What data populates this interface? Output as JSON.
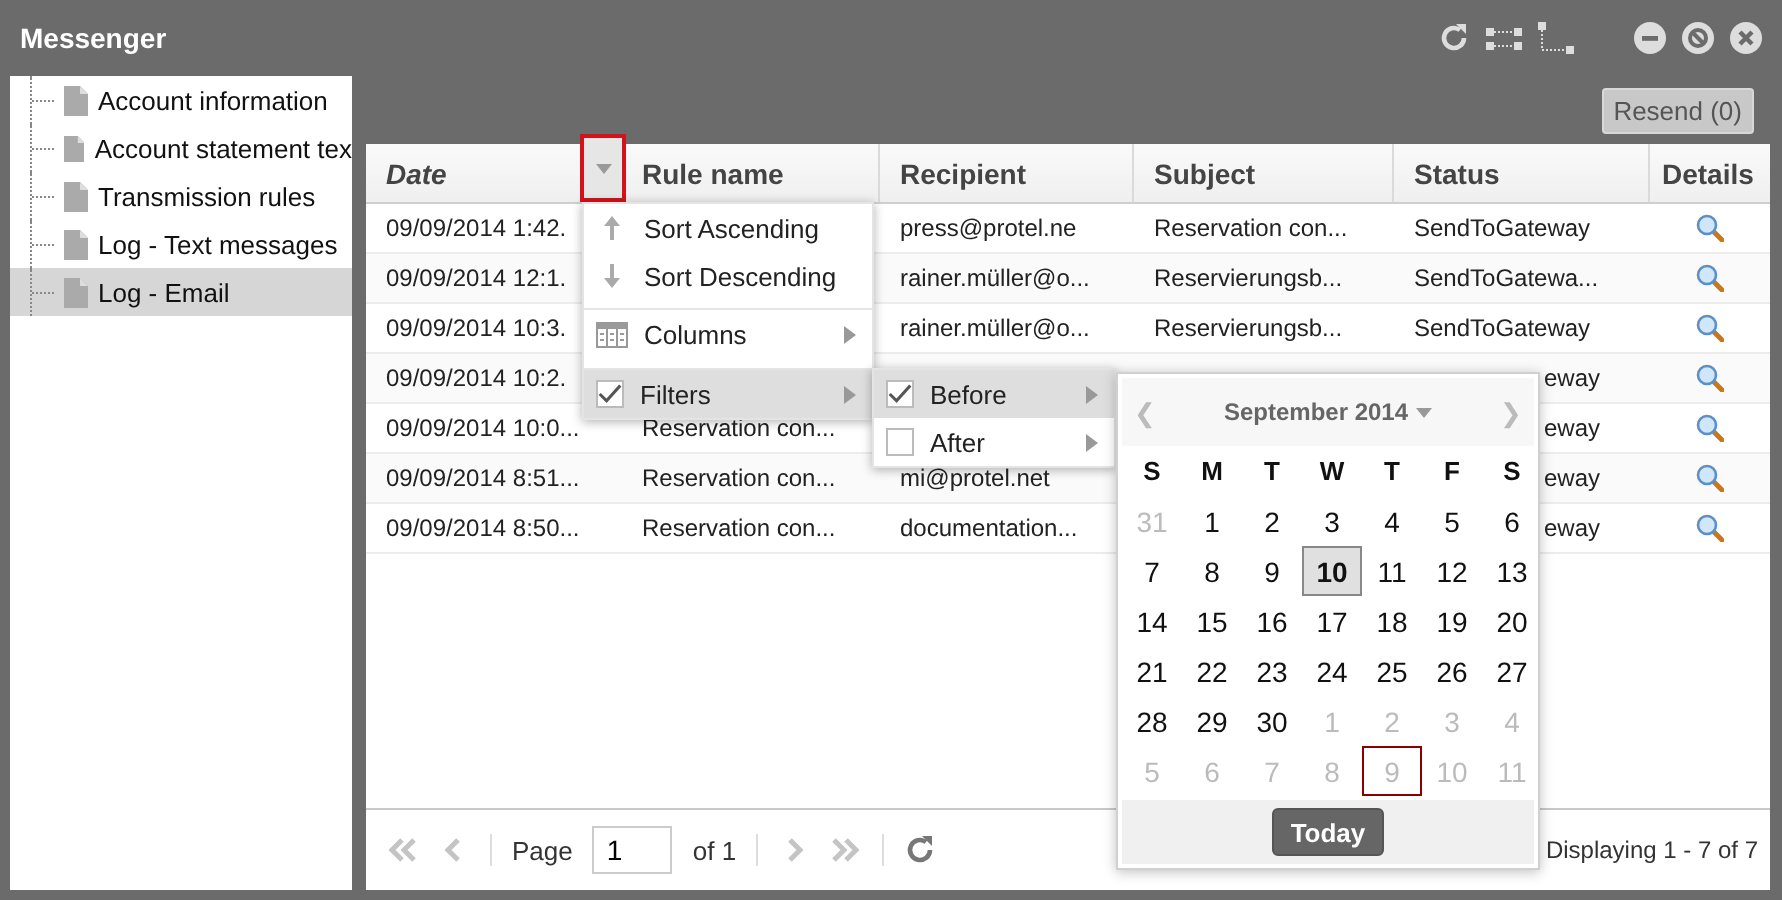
{
  "window": {
    "title": "Messenger"
  },
  "sidebar": {
    "items": [
      {
        "label": "Account information",
        "selected": false
      },
      {
        "label": "Account statement tex",
        "selected": false
      },
      {
        "label": "Transmission rules",
        "selected": false
      },
      {
        "label": "Log - Text messages",
        "selected": false
      },
      {
        "label": "Log - Email",
        "selected": true
      }
    ]
  },
  "toolbar": {
    "resend_button": "Resend (0)"
  },
  "grid": {
    "columns": [
      {
        "label": "Date",
        "filtered": true,
        "menu_open": true
      },
      {
        "label": "Rule name",
        "filtered": false,
        "menu_open": false
      },
      {
        "label": "Recipient",
        "filtered": false,
        "menu_open": false
      },
      {
        "label": "Subject",
        "filtered": false,
        "menu_open": false
      },
      {
        "label": "Status",
        "filtered": false,
        "menu_open": false
      },
      {
        "label": "Details",
        "filtered": false,
        "menu_open": false
      }
    ],
    "rows": [
      {
        "date": "09/09/2014 1:42.",
        "recipient": "press@protel.ne",
        "subject": "Reservation con...",
        "status": "SendToGateway"
      },
      {
        "date": "09/09/2014 12:1.",
        "recipient": "rainer.müller@o...",
        "subject": "Reservierungsb...",
        "status": "SendToGatewa..."
      },
      {
        "date": "09/09/2014 10:3.",
        "recipient": "rainer.müller@o...",
        "subject": "Reservierungsb...",
        "status": "SendToGateway"
      },
      {
        "date": "09/09/2014 10:2.",
        "status": "eway"
      },
      {
        "date": "09/09/2014 10:0...",
        "rule_name": "Reservation con...",
        "status": "eway"
      },
      {
        "date": "09/09/2014 8:51...",
        "rule_name": "Reservation con...",
        "recipient": "mi@protel.net",
        "status": "eway"
      },
      {
        "date": "09/09/2014 8:50...",
        "rule_name": "Reservation con...",
        "recipient": "documentation...",
        "status": "eway"
      }
    ]
  },
  "column_menu": {
    "items": [
      {
        "kind": "sort-asc",
        "label": "Sort Ascending",
        "highlighted": false,
        "submenu": false
      },
      {
        "kind": "sort-desc",
        "label": "Sort Descending",
        "highlighted": false,
        "submenu": false
      },
      {
        "kind": "columns",
        "label": "Columns",
        "highlighted": false,
        "submenu": true
      },
      {
        "kind": "check",
        "label": "Filters",
        "checked": true,
        "highlighted": true,
        "submenu": true
      }
    ]
  },
  "filter_menu": {
    "items": [
      {
        "label": "Before",
        "checked": true,
        "highlighted": true
      },
      {
        "label": "After",
        "checked": false,
        "highlighted": false
      }
    ]
  },
  "date_picker": {
    "prev": "❮",
    "next": "❯",
    "month_label": "September 2014",
    "weekdays": [
      "S",
      "M",
      "T",
      "W",
      "T",
      "F",
      "S"
    ],
    "weeks": [
      [
        {
          "day": "31",
          "other_month": true,
          "selected": false,
          "today": false
        },
        {
          "day": "1",
          "other_month": false,
          "selected": false,
          "today": false
        },
        {
          "day": "2",
          "other_month": false,
          "selected": false,
          "today": false
        },
        {
          "day": "3",
          "other_month": false,
          "selected": false,
          "today": false
        },
        {
          "day": "4",
          "other_month": false,
          "selected": false,
          "today": false
        },
        {
          "day": "5",
          "other_month": false,
          "selected": false,
          "today": false
        },
        {
          "day": "6",
          "other_month": false,
          "selected": false,
          "today": false
        }
      ],
      [
        {
          "day": "7",
          "other_month": false,
          "selected": false,
          "today": false
        },
        {
          "day": "8",
          "other_month": false,
          "selected": false,
          "today": false
        },
        {
          "day": "9",
          "other_month": false,
          "selected": false,
          "today": false
        },
        {
          "day": "10",
          "other_month": false,
          "selected": true,
          "today": false
        },
        {
          "day": "11",
          "other_month": false,
          "selected": false,
          "today": false
        },
        {
          "day": "12",
          "other_month": false,
          "selected": false,
          "today": false
        },
        {
          "day": "13",
          "other_month": false,
          "selected": false,
          "today": false
        }
      ],
      [
        {
          "day": "14",
          "other_month": false,
          "selected": false,
          "today": false
        },
        {
          "day": "15",
          "other_month": false,
          "selected": false,
          "today": false
        },
        {
          "day": "16",
          "other_month": false,
          "selected": false,
          "today": false
        },
        {
          "day": "17",
          "other_month": false,
          "selected": false,
          "today": false
        },
        {
          "day": "18",
          "other_month": false,
          "selected": false,
          "today": false
        },
        {
          "day": "19",
          "other_month": false,
          "selected": false,
          "today": false
        },
        {
          "day": "20",
          "other_month": false,
          "selected": false,
          "today": false
        }
      ],
      [
        {
          "day": "21",
          "other_month": false,
          "selected": false,
          "today": false
        },
        {
          "day": "22",
          "other_month": false,
          "selected": false,
          "today": false
        },
        {
          "day": "23",
          "other_month": false,
          "selected": false,
          "today": false
        },
        {
          "day": "24",
          "other_month": false,
          "selected": false,
          "today": false
        },
        {
          "day": "25",
          "other_month": false,
          "selected": false,
          "today": false
        },
        {
          "day": "26",
          "other_month": false,
          "selected": false,
          "today": false
        },
        {
          "day": "27",
          "other_month": false,
          "selected": false,
          "today": false
        }
      ],
      [
        {
          "day": "28",
          "other_month": false,
          "selected": false,
          "today": false
        },
        {
          "day": "29",
          "other_month": false,
          "selected": false,
          "today": false
        },
        {
          "day": "30",
          "other_month": false,
          "selected": false,
          "today": false
        },
        {
          "day": "1",
          "other_month": true,
          "selected": false,
          "today": false
        },
        {
          "day": "2",
          "other_month": true,
          "selected": false,
          "today": false
        },
        {
          "day": "3",
          "other_month": true,
          "selected": false,
          "today": false
        },
        {
          "day": "4",
          "other_month": true,
          "selected": false,
          "today": false
        }
      ],
      [
        {
          "day": "5",
          "other_month": true,
          "selected": false,
          "today": false
        },
        {
          "day": "6",
          "other_month": true,
          "selected": false,
          "today": false
        },
        {
          "day": "7",
          "other_month": true,
          "selected": false,
          "today": false
        },
        {
          "day": "8",
          "other_month": true,
          "selected": false,
          "today": false
        },
        {
          "day": "9",
          "other_month": true,
          "selected": false,
          "today": true
        },
        {
          "day": "10",
          "other_month": true,
          "selected": false,
          "today": false
        },
        {
          "day": "11",
          "other_month": true,
          "selected": false,
          "today": false
        }
      ]
    ],
    "today_button": "Today"
  },
  "paging": {
    "nav_disabled": true,
    "page_label": "Page",
    "page_value": "1",
    "of_label": "of 1",
    "display_info": "Displaying 1 - 7 of 7"
  }
}
